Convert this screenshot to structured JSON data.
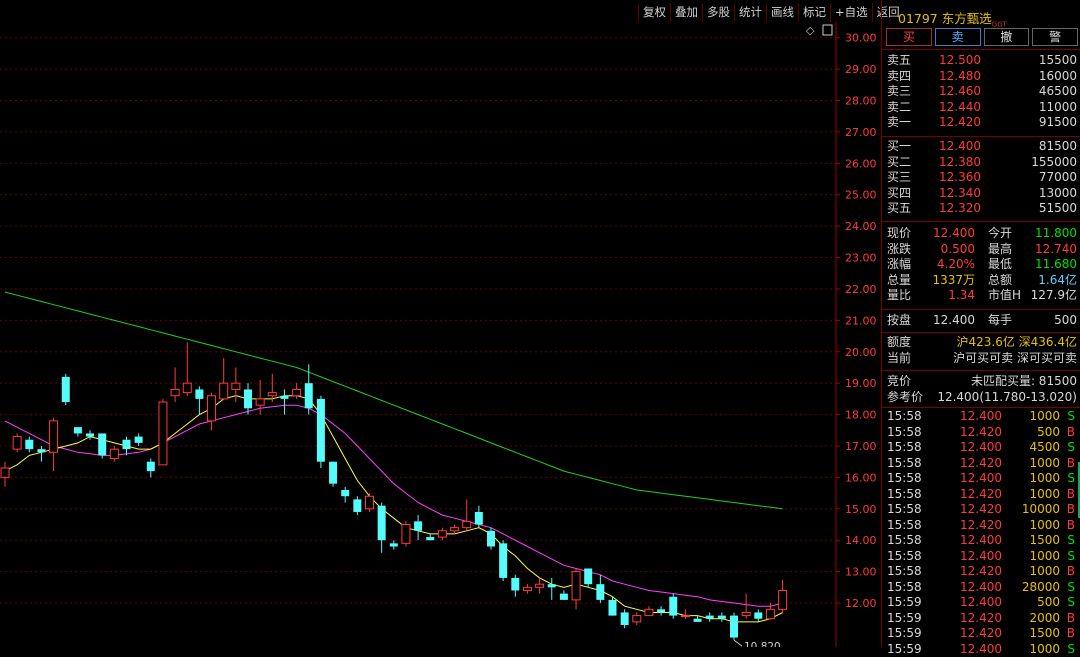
{
  "toolbar": [
    "复权",
    "叠加",
    "多股",
    "统计",
    "画线",
    "标记",
    "+自选",
    "返回"
  ],
  "stock": {
    "code": "01797",
    "name": "东方甄选",
    "badge": "GGT"
  },
  "trade_buttons": [
    "买",
    "卖",
    "撤",
    "警"
  ],
  "asks": [
    {
      "label": "卖五",
      "price": "12.500",
      "vol": "15500"
    },
    {
      "label": "卖四",
      "price": "12.480",
      "vol": "16000"
    },
    {
      "label": "卖三",
      "price": "12.460",
      "vol": "46500"
    },
    {
      "label": "卖二",
      "price": "12.440",
      "vol": "11000"
    },
    {
      "label": "卖一",
      "price": "12.420",
      "vol": "91500"
    }
  ],
  "bids": [
    {
      "label": "买一",
      "price": "12.400",
      "vol": "81500"
    },
    {
      "label": "买二",
      "price": "12.380",
      "vol": "155000"
    },
    {
      "label": "买三",
      "price": "12.360",
      "vol": "77000"
    },
    {
      "label": "买四",
      "price": "12.340",
      "vol": "13000"
    },
    {
      "label": "买五",
      "price": "12.320",
      "vol": "51500"
    }
  ],
  "quote": [
    {
      "l1": "现价",
      "v1": "12.400",
      "c1": "red",
      "l2": "今开",
      "v2": "11.800",
      "c2": "green"
    },
    {
      "l1": "涨跌",
      "v1": "0.500",
      "c1": "red",
      "l2": "最高",
      "v2": "12.740",
      "c2": "red"
    },
    {
      "l1": "涨幅",
      "v1": "4.20%",
      "c1": "red",
      "l2": "最低",
      "v2": "11.680",
      "c2": "green"
    },
    {
      "l1": "总量",
      "v1": "1337万",
      "c1": "yellow",
      "l2": "总额",
      "v2": "1.64亿",
      "c2": "cyan"
    },
    {
      "l1": "量比",
      "v1": "1.34",
      "c1": "red",
      "l2": "市值H",
      "v2": "127.9亿",
      "c2": "white"
    }
  ],
  "panpan": {
    "l1": "按盘",
    "v1": "12.400",
    "l2": "每手",
    "v2": "500"
  },
  "quota": {
    "label": "额度",
    "value": "沪423.6亿 深436.4亿"
  },
  "current": {
    "label": "当前",
    "value": "沪可买可卖 深可买可卖"
  },
  "auction": {
    "label": "竞价",
    "value": "未匹配买量: 81500"
  },
  "ref": {
    "label": "参考价",
    "value": "12.400(11.780-13.020)"
  },
  "ticks": [
    [
      "15:58",
      "12.400",
      "1000",
      "S"
    ],
    [
      "15:58",
      "12.420",
      "500",
      "B"
    ],
    [
      "15:58",
      "12.400",
      "4500",
      "S"
    ],
    [
      "15:58",
      "12.420",
      "1000",
      "B"
    ],
    [
      "15:58",
      "12.400",
      "1000",
      "S"
    ],
    [
      "15:58",
      "12.420",
      "1000",
      "B"
    ],
    [
      "15:58",
      "12.420",
      "10000",
      "B"
    ],
    [
      "15:58",
      "12.420",
      "1000",
      "B"
    ],
    [
      "15:58",
      "12.400",
      "1500",
      "S"
    ],
    [
      "15:58",
      "12.400",
      "1000",
      "S"
    ],
    [
      "15:58",
      "12.420",
      "1000",
      "B"
    ],
    [
      "15:58",
      "12.400",
      "28000",
      "S"
    ],
    [
      "15:59",
      "12.400",
      "500",
      "S"
    ],
    [
      "15:59",
      "12.420",
      "2000",
      "B"
    ],
    [
      "15:59",
      "12.420",
      "1500",
      "B"
    ],
    [
      "15:59",
      "12.400",
      "1000",
      "S"
    ]
  ],
  "chart_data": {
    "type": "candlestick",
    "y_ticks": [
      "30.00",
      "29.00",
      "28.00",
      "27.00",
      "26.00",
      "25.00",
      "24.00",
      "23.00",
      "22.00",
      "21.00",
      "20.00",
      "19.00",
      "18.00",
      "17.00",
      "16.00",
      "15.00",
      "14.00",
      "13.00",
      "12.00"
    ],
    "ylim": [
      10.6,
      30.5
    ],
    "low_label": "10.820",
    "candles": [
      [
        16.0,
        16.3,
        15.7,
        16.5
      ],
      [
        16.9,
        17.3,
        16.8,
        17.4
      ],
      [
        17.2,
        16.9,
        16.8,
        17.3
      ],
      [
        16.9,
        16.8,
        16.5,
        17.0
      ],
      [
        16.8,
        17.8,
        16.2,
        17.9
      ],
      [
        19.2,
        18.4,
        18.3,
        19.3
      ],
      [
        17.6,
        17.4,
        17.3,
        17.6
      ],
      [
        17.4,
        17.3,
        17.2,
        17.5
      ],
      [
        17.4,
        16.7,
        16.6,
        17.4
      ],
      [
        16.6,
        16.9,
        16.5,
        17.0
      ],
      [
        17.2,
        16.9,
        16.7,
        17.3
      ],
      [
        17.3,
        17.1,
        17.0,
        17.4
      ],
      [
        16.5,
        16.2,
        16.0,
        16.6
      ],
      [
        16.4,
        18.4,
        16.4,
        18.5
      ],
      [
        18.6,
        18.8,
        18.4,
        19.5
      ],
      [
        18.7,
        19.0,
        18.6,
        20.3
      ],
      [
        18.8,
        18.5,
        18.0,
        18.9
      ],
      [
        17.8,
        18.6,
        17.5,
        18.7
      ],
      [
        18.5,
        19.0,
        18.5,
        19.8
      ],
      [
        18.8,
        19.0,
        18.4,
        19.5
      ],
      [
        18.8,
        18.2,
        18.0,
        19.0
      ],
      [
        18.3,
        18.5,
        18.0,
        19.1
      ],
      [
        18.6,
        18.7,
        18.4,
        19.3
      ],
      [
        18.6,
        18.5,
        18.0,
        18.8
      ],
      [
        18.6,
        18.8,
        18.5,
        19.0
      ],
      [
        19.0,
        18.2,
        18.0,
        19.6
      ],
      [
        18.5,
        16.5,
        16.3,
        18.6
      ],
      [
        16.5,
        15.8,
        15.7,
        16.5
      ],
      [
        15.6,
        15.4,
        15.2,
        15.7
      ],
      [
        15.3,
        14.9,
        14.8,
        15.4
      ],
      [
        15.0,
        15.4,
        14.9,
        15.5
      ],
      [
        15.1,
        14.0,
        13.6,
        15.2
      ],
      [
        13.9,
        13.8,
        13.7,
        14.0
      ],
      [
        13.9,
        14.5,
        13.8,
        14.6
      ],
      [
        14.6,
        14.3,
        14.0,
        14.8
      ],
      [
        14.1,
        14.0,
        14.0,
        14.2
      ],
      [
        14.1,
        14.3,
        14.0,
        14.4
      ],
      [
        14.3,
        14.4,
        14.2,
        14.5
      ],
      [
        14.4,
        14.6,
        14.3,
        15.3
      ],
      [
        14.9,
        14.5,
        14.4,
        15.1
      ],
      [
        14.3,
        13.8,
        13.7,
        14.4
      ],
      [
        13.9,
        12.8,
        12.7,
        14.0
      ],
      [
        12.8,
        12.4,
        12.2,
        12.9
      ],
      [
        12.4,
        12.5,
        12.3,
        12.6
      ],
      [
        12.5,
        12.6,
        12.3,
        12.8
      ],
      [
        12.6,
        12.5,
        12.1,
        12.8
      ],
      [
        12.3,
        12.1,
        12.1,
        12.4
      ],
      [
        12.1,
        13.0,
        11.8,
        13.1
      ],
      [
        13.1,
        12.6,
        12.5,
        13.1
      ],
      [
        12.6,
        12.1,
        12.0,
        12.9
      ],
      [
        12.1,
        11.6,
        11.6,
        12.2
      ],
      [
        11.7,
        11.3,
        11.2,
        11.8
      ],
      [
        11.4,
        11.6,
        11.3,
        11.7
      ],
      [
        11.6,
        11.8,
        11.6,
        11.9
      ],
      [
        11.8,
        11.7,
        11.6,
        11.9
      ],
      [
        12.2,
        11.6,
        11.5,
        12.3
      ],
      [
        11.6,
        11.6,
        11.5,
        11.8
      ],
      [
        11.5,
        11.4,
        11.4,
        11.6
      ],
      [
        11.6,
        11.5,
        11.4,
        11.7
      ],
      [
        11.6,
        11.5,
        11.4,
        11.7
      ],
      [
        11.6,
        10.9,
        10.82,
        11.7
      ],
      [
        11.6,
        11.7,
        11.5,
        12.3
      ],
      [
        11.7,
        11.5,
        11.4,
        11.8
      ],
      [
        11.5,
        11.8,
        11.5,
        12.0
      ],
      [
        11.8,
        12.4,
        11.7,
        12.74
      ]
    ],
    "ma_short": [
      16.2,
      16.4,
      16.7,
      16.8,
      16.9,
      17.0,
      17.1,
      17.3,
      17.2,
      17.1,
      17.0,
      16.9,
      16.9,
      17.1,
      17.4,
      17.7,
      18.0,
      18.2,
      18.5,
      18.6,
      18.5,
      18.5,
      18.5,
      18.6,
      18.6,
      18.5,
      18.0,
      17.3,
      16.6,
      15.9,
      15.4,
      15.0,
      14.7,
      14.4,
      14.3,
      14.2,
      14.2,
      14.2,
      14.3,
      14.4,
      14.2,
      13.8,
      13.5,
      13.1,
      12.8,
      12.6,
      12.5,
      12.6,
      12.5,
      12.4,
      12.2,
      11.9,
      11.8,
      11.7,
      11.7,
      11.7,
      11.6,
      11.6,
      11.5,
      11.5,
      11.4,
      11.4,
      11.4,
      11.5,
      11.7
    ],
    "ma_mid": [
      17.8,
      17.6,
      17.4,
      17.2,
      17.0,
      16.9,
      16.8,
      16.75,
      16.7,
      16.7,
      16.75,
      16.8,
      16.9,
      17.1,
      17.3,
      17.5,
      17.7,
      17.8,
      17.9,
      18.0,
      18.1,
      18.2,
      18.25,
      18.3,
      18.3,
      18.2,
      18.0,
      17.7,
      17.4,
      17.0,
      16.6,
      16.2,
      15.8,
      15.5,
      15.2,
      15.0,
      14.8,
      14.7,
      14.6,
      14.5,
      14.4,
      14.2,
      14.0,
      13.8,
      13.6,
      13.4,
      13.2,
      13.1,
      13.0,
      12.9,
      12.7,
      12.6,
      12.5,
      12.4,
      12.35,
      12.3,
      12.25,
      12.2,
      12.1,
      12.05,
      12.0,
      11.95,
      11.9,
      11.9,
      12.0
    ],
    "ma_long": [
      21.9,
      21.8,
      21.7,
      21.6,
      21.5,
      21.4,
      21.3,
      21.2,
      21.1,
      21.0,
      20.9,
      20.8,
      20.7,
      20.6,
      20.5,
      20.4,
      20.3,
      20.2,
      20.1,
      20.0,
      19.9,
      19.8,
      19.7,
      19.6,
      19.5,
      19.35,
      19.2,
      19.05,
      18.9,
      18.75,
      18.6,
      18.45,
      18.3,
      18.15,
      18.0,
      17.85,
      17.7,
      17.55,
      17.4,
      17.25,
      17.1,
      16.95,
      16.8,
      16.65,
      16.5,
      16.35,
      16.2,
      16.1,
      16.0,
      15.9,
      15.8,
      15.7,
      15.6,
      15.55,
      15.5,
      15.45,
      15.4,
      15.35,
      15.3,
      15.25,
      15.2,
      15.15,
      15.1,
      15.05,
      15.0
    ],
    "colors": {
      "up": "#ff3b3b",
      "down": "#54fcfc",
      "ma_short": "#ffff40",
      "ma_mid": "#ff40ff",
      "ma_long": "#20d020",
      "axis": "#a00000",
      "grid": "#6a0000",
      "label": "#ff3b3b"
    }
  }
}
